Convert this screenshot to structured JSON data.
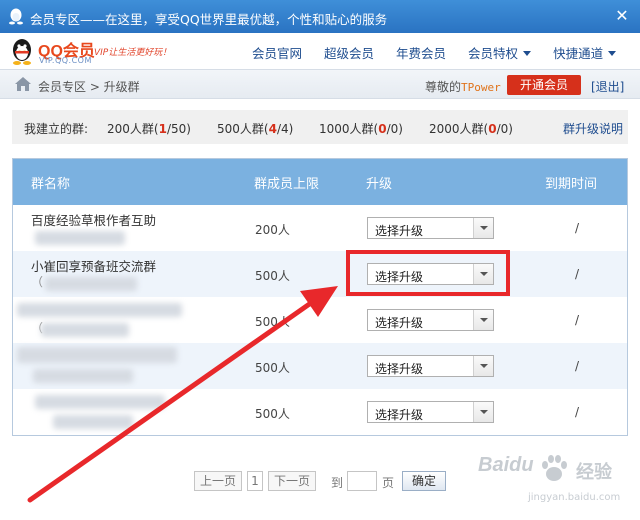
{
  "window": {
    "title": "会员专区——在这里，享受QQ世界里最优越，个性和贴心的服务",
    "close_icon": "close-icon"
  },
  "logo": {
    "text": "QQ会员",
    "url": "VIP.QQ.COM",
    "slogan": "VIP让生活更好玩！"
  },
  "nav": {
    "items": [
      "会员官网",
      "超级会员",
      "年费会员",
      "会员特权",
      "快捷通道"
    ]
  },
  "breadcrumb": {
    "path": "会员专区 > 升级群",
    "greeting_prefix": "尊敬的",
    "username": "TPower",
    "open_button": "开通会员",
    "logout": "[退出]"
  },
  "stats": {
    "label": "我建立的群:",
    "groups": [
      {
        "type": "200人群",
        "count": "1",
        "max": "50"
      },
      {
        "type": "500人群",
        "count": "4",
        "max": "4"
      },
      {
        "type": "1000人群",
        "count": "0",
        "max": "0"
      },
      {
        "type": "2000人群",
        "count": "0",
        "max": "0"
      }
    ],
    "help_link": "群升级说明"
  },
  "table": {
    "headers": {
      "name": "群名称",
      "limit": "群成员上限",
      "upgrade": "升级",
      "expire": "到期时间"
    },
    "rows": [
      {
        "name": "百度经验草根作者互助",
        "id": "",
        "limit": "200人",
        "select": "选择升级",
        "expire": "/"
      },
      {
        "name": "小崔回享预备班交流群",
        "id": "（",
        "limit": "500人",
        "select": "选择升级",
        "expire": "/"
      },
      {
        "name": "",
        "id": "（",
        "limit": "500人",
        "select": "选择升级",
        "expire": "/"
      },
      {
        "name": "",
        "id": "",
        "limit": "500人",
        "select": "选择升级",
        "expire": "/"
      },
      {
        "name": "",
        "id": "",
        "limit": "500人",
        "select": "选择升级",
        "expire": "/"
      }
    ]
  },
  "pager": {
    "prev": "上一页",
    "page": "1",
    "next": "下一页",
    "goto_prefix": "到",
    "goto_suffix": "页",
    "confirm": "确定"
  },
  "watermark": {
    "brand": "Baidu",
    "cn": "经验",
    "url": "jingyan.baidu.com"
  },
  "colors": {
    "title_bar": "#2f7fcf",
    "table_header": "#7bb1e0",
    "accent_red": "#d6301b",
    "annotation_red": "#e8282b",
    "link_blue": "#1f4d8f"
  }
}
